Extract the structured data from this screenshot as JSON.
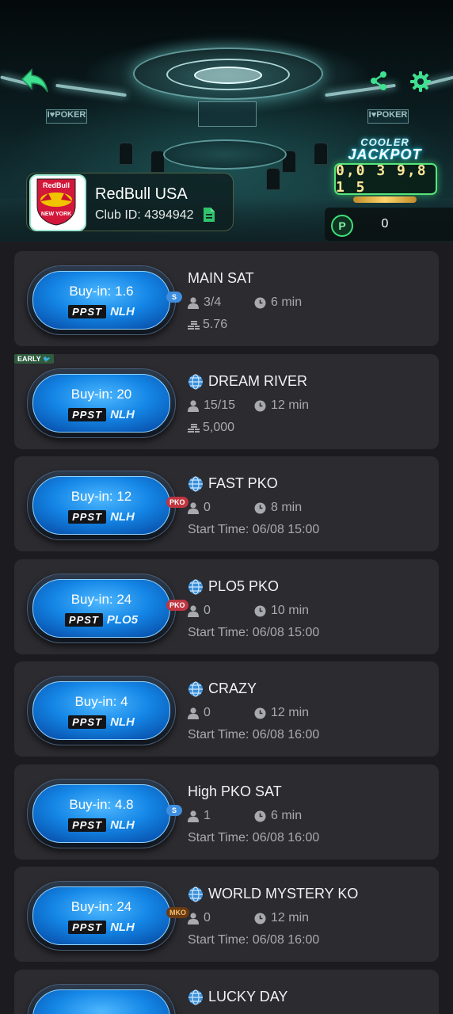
{
  "club": {
    "name": "RedBull USA",
    "id_label": "Club ID: 4394942",
    "logo_text_top": "RedBull",
    "logo_text_bottom": "NEW YORK"
  },
  "room_signs": {
    "left": "I♥POKER",
    "right": "I♥POKER"
  },
  "jackpot": {
    "cooler": "COOLER",
    "title": "JACKPOT",
    "value": "0,0 3 9,8 1 5"
  },
  "points": {
    "icon": "P",
    "value": "0"
  },
  "icons": {
    "back": "back-arrow-icon",
    "share": "share-icon",
    "settings": "gear-icon",
    "copy": "copy-icon",
    "globe": "globe-icon",
    "player": "player-icon",
    "clock": "clock-icon",
    "coins": "coins-icon"
  },
  "colors": {
    "badge_blue": "#1486e6",
    "card_bg": "#2b2b30",
    "page_bg": "#1c1c20",
    "jackpot_green": "#56e67a",
    "pko_red": "#c03540"
  },
  "early_tag": "EARLY",
  "tournaments": [
    {
      "buyin": "Buy-in:  1.6",
      "brand": "PPST",
      "game": "NLH",
      "tag": "S",
      "name": "MAIN SAT",
      "globe": false,
      "players": "3/4",
      "time": "6 min",
      "prize": "5.76",
      "start": ""
    },
    {
      "buyin": "Buy-in:  20",
      "brand": "PPST",
      "game": "NLH",
      "tag": "",
      "name": "DREAM RIVER",
      "globe": true,
      "players": "15/15",
      "time": "12 min",
      "prize": "5,000",
      "start": ""
    },
    {
      "buyin": "Buy-in:  12",
      "brand": "PPST",
      "game": "NLH",
      "tag": "PKO",
      "name": "FAST PKO",
      "globe": true,
      "players": "0",
      "time": "8 min",
      "prize": "",
      "start": "Start Time: 06/08 15:00"
    },
    {
      "buyin": "Buy-in:  24",
      "brand": "PPST",
      "game": "PLO5",
      "tag": "PKO",
      "name": "PLO5 PKO",
      "globe": true,
      "players": "0",
      "time": "10 min",
      "prize": "",
      "start": "Start Time: 06/08 15:00"
    },
    {
      "buyin": "Buy-in:  4",
      "brand": "PPST",
      "game": "NLH",
      "tag": "",
      "name": "CRAZY",
      "globe": true,
      "players": "0",
      "time": "12 min",
      "prize": "",
      "start": "Start Time: 06/08 16:00"
    },
    {
      "buyin": "Buy-in:  4.8",
      "brand": "PPST",
      "game": "NLH",
      "tag": "S",
      "name": "High PKO SAT",
      "globe": false,
      "players": "1",
      "time": "6 min",
      "prize": "",
      "start": "Start Time: 06/08 16:00"
    },
    {
      "buyin": "Buy-in:  24",
      "brand": "PPST",
      "game": "NLH",
      "tag": "MKO",
      "name": "WORLD MYSTERY KO",
      "globe": true,
      "players": "0",
      "time": "12 min",
      "prize": "",
      "start": "Start Time: 06/08 16:00"
    },
    {
      "buyin": "",
      "brand": "",
      "game": "",
      "tag": "",
      "name": "LUCKY DAY",
      "globe": true,
      "players": "",
      "time": "",
      "prize": "",
      "start": ""
    }
  ]
}
